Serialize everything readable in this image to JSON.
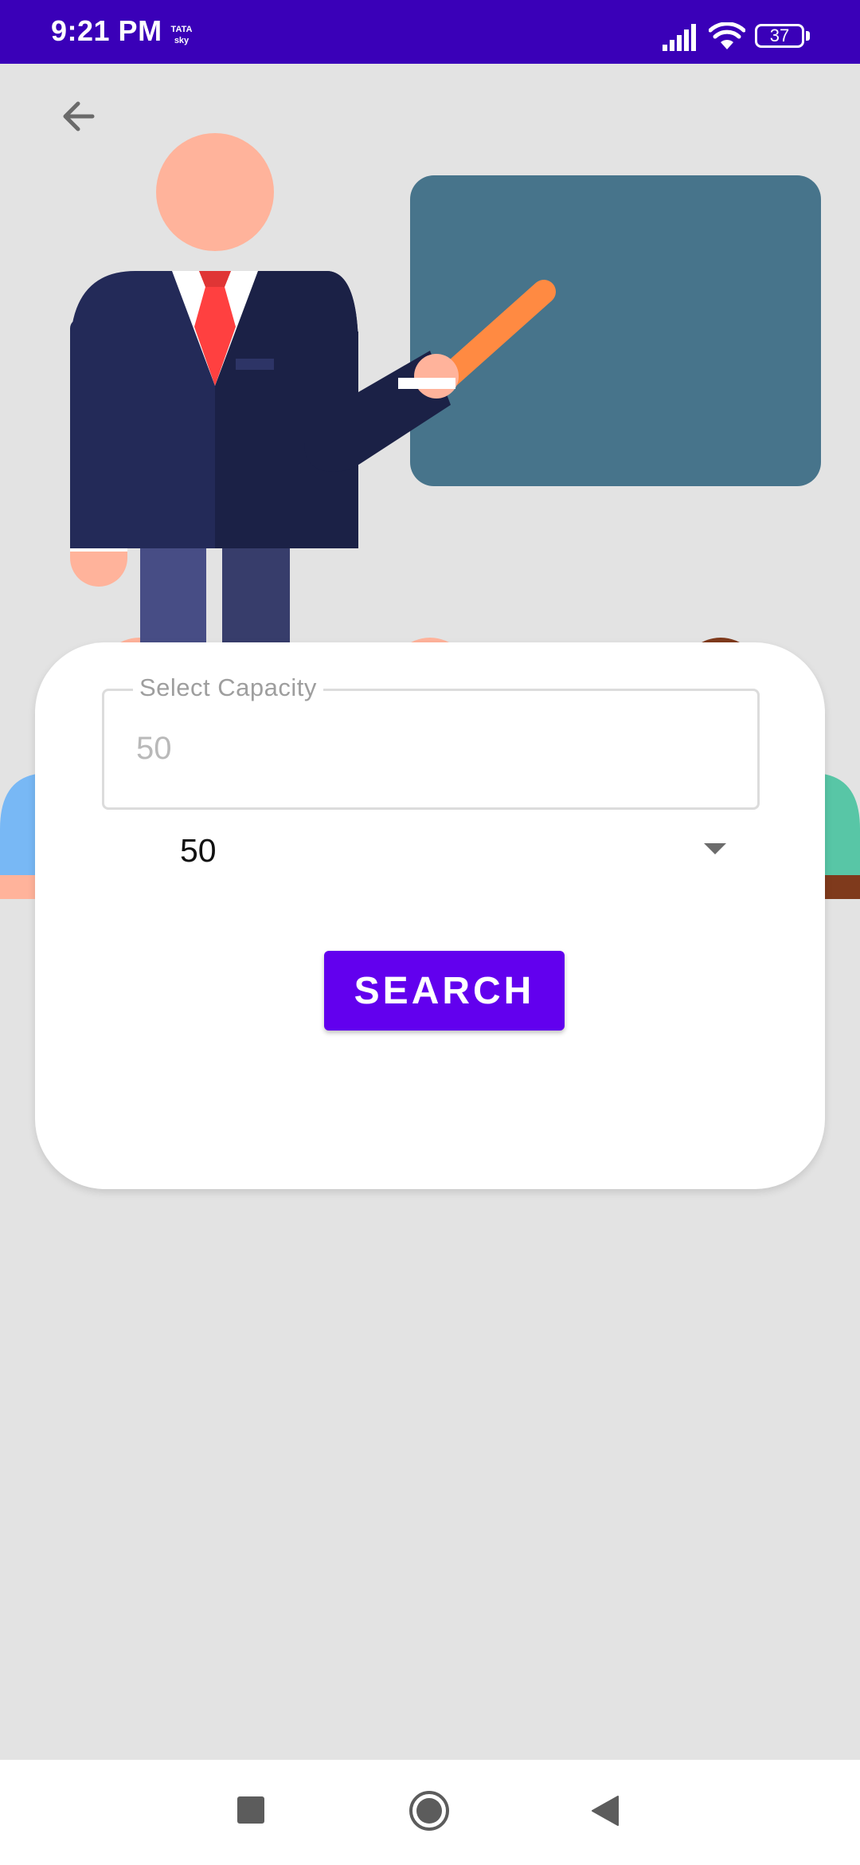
{
  "status_bar": {
    "time": "9:21 PM",
    "carrier_line1": "TATA",
    "carrier_line2": "sky",
    "battery_level": "37",
    "signal_icon": "cellular-signal-icon",
    "wifi_icon": "wifi-icon",
    "background_color": "#3a00b8"
  },
  "header": {
    "back_icon": "arrow-back-icon"
  },
  "illustration": {
    "subject": "teacher-presenting-to-audience",
    "board_color": "#47748b",
    "suit_color": "#1e2448",
    "tie_color": "#ff4040",
    "pointer_color": "#ff8a42",
    "skin_color": "#ffb39b"
  },
  "form": {
    "capacity_label": "Select Capacity",
    "capacity_placeholder": "50",
    "capacity_value": "",
    "dropdown_selected": "50",
    "dropdown_icon": "arrow-drop-down-icon",
    "search_label": "SEARCH",
    "accent_color": "#6200ee"
  },
  "navigation_bar": {
    "recents_icon": "recents-square-icon",
    "home_icon": "home-circle-icon",
    "back_icon": "back-triangle-icon"
  }
}
